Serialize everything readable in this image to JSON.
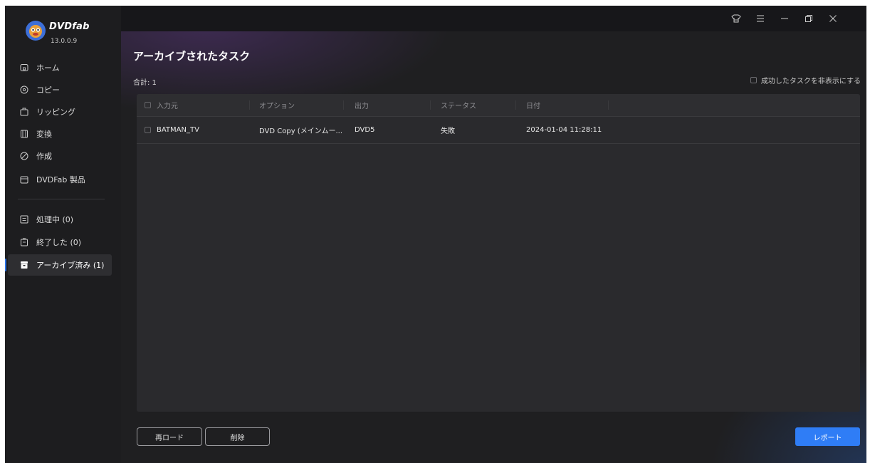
{
  "app": {
    "name": "DVDfab",
    "version": "13.0.0.9"
  },
  "sidebar": {
    "items": [
      {
        "label": "ホーム",
        "icon": "home-icon"
      },
      {
        "label": "コピー",
        "icon": "copy-disc-icon"
      },
      {
        "label": "リッピング",
        "icon": "ripping-icon"
      },
      {
        "label": "変換",
        "icon": "film-icon"
      },
      {
        "label": "作成",
        "icon": "creator-icon"
      },
      {
        "label": "DVDFab 製品",
        "icon": "products-icon"
      }
    ],
    "queue": [
      {
        "label": "処理中 (0)",
        "icon": "processing-icon"
      },
      {
        "label": "終了した (0)",
        "icon": "finished-icon"
      },
      {
        "label": "アーカイブ済み (1)",
        "icon": "archive-icon",
        "active": true
      }
    ]
  },
  "main": {
    "title": "アーカイブされたタスク",
    "total": "合計: 1",
    "hide_success_label": "成功したタスクを非表示にする",
    "columns": [
      "入力元",
      "オプション",
      "出力",
      "ステータス",
      "日付"
    ],
    "rows": [
      {
        "source": "BATMAN_TV",
        "option": "DVD Copy (メインムー...",
        "output": "DVD5",
        "status": "失敗",
        "date": "2024-01-04 11:28:11"
      }
    ],
    "buttons": {
      "reload": "再ロード",
      "delete": "削除",
      "report": "レポート"
    }
  },
  "colors": {
    "accent": "#2f7df6",
    "sidebar_bg": "#1d1d1f",
    "main_bg": "#1f1f21",
    "table_bg": "#2a2a2d"
  }
}
